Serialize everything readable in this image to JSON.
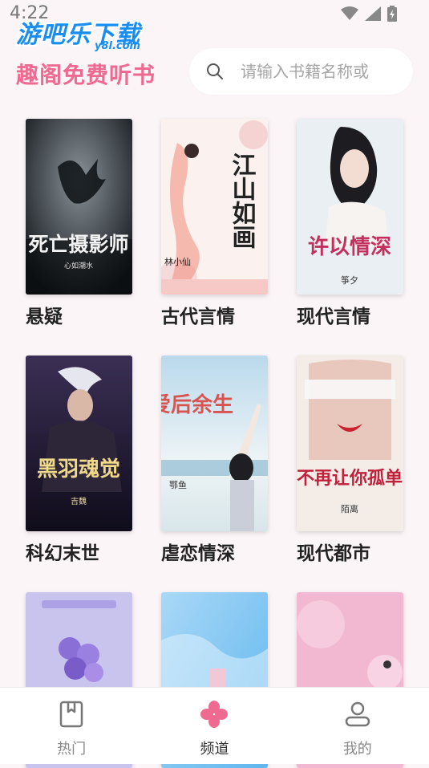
{
  "status_bar": {
    "time": "4:22"
  },
  "watermark": {
    "main": "游吧乐下载",
    "sub": "y8l.com"
  },
  "header": {
    "title": "趣阁免费听书",
    "search_placeholder": "请输入书籍名称或"
  },
  "categories": [
    {
      "label": "悬疑",
      "cover_title": "死亡摄影师",
      "cover_author": "心如潮水"
    },
    {
      "label": "古代言情",
      "cover_title": "江山如画",
      "cover_author": "林小仙"
    },
    {
      "label": "现代言情",
      "cover_title": "许以情深",
      "cover_author": "筝夕"
    },
    {
      "label": "科幻末世",
      "cover_title": "黑羽魂觉",
      "cover_author": "吉魏"
    },
    {
      "label": "虐恋情深",
      "cover_title": "爱后余生",
      "cover_author": "鄂鱼"
    },
    {
      "label": "现代都市",
      "cover_title": "不再让你孤单",
      "cover_author": "陌离"
    },
    {
      "label": "",
      "cover_title": ""
    },
    {
      "label": "",
      "cover_title": ""
    },
    {
      "label": "",
      "cover_title": ""
    }
  ],
  "tabbar": {
    "tabs": [
      {
        "label": "热门",
        "icon": "bookmark-icon"
      },
      {
        "label": "频道",
        "icon": "flower-icon",
        "active": true
      },
      {
        "label": "我的",
        "icon": "user-icon"
      }
    ],
    "accent": "#ef6a91"
  }
}
